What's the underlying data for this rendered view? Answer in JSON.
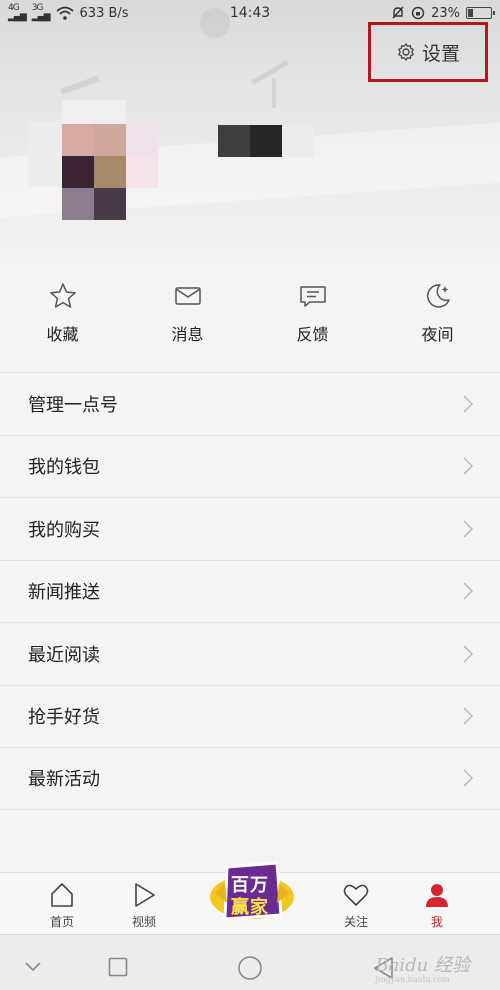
{
  "status_bar": {
    "signal1": "4G",
    "signal2": "3G",
    "net_speed": "633 B/s",
    "time": "14:43",
    "battery_pct": "23%",
    "battery_level": 0.23
  },
  "header": {
    "settings_label": "设置"
  },
  "quick_actions": [
    {
      "label": "收藏",
      "icon": "star-icon"
    },
    {
      "label": "消息",
      "icon": "mail-icon"
    },
    {
      "label": "反馈",
      "icon": "feedback-icon"
    },
    {
      "label": "夜间",
      "icon": "moon-icon"
    }
  ],
  "menu": [
    {
      "label": "管理一点号"
    },
    {
      "label": "我的钱包"
    },
    {
      "label": "我的购买"
    },
    {
      "label": "新闻推送"
    },
    {
      "label": "最近阅读"
    },
    {
      "label": "抢手好货"
    },
    {
      "label": "最新活动"
    }
  ],
  "tab_bar": {
    "home": "首页",
    "video": "视频",
    "promo_line1": "百万",
    "promo_line2": "赢家",
    "follow": "关注",
    "me": "我",
    "active": "me",
    "accent": "#d2272e"
  },
  "watermark": {
    "text": "Baidu 经验",
    "sub": "jingyan.baidu.com"
  }
}
